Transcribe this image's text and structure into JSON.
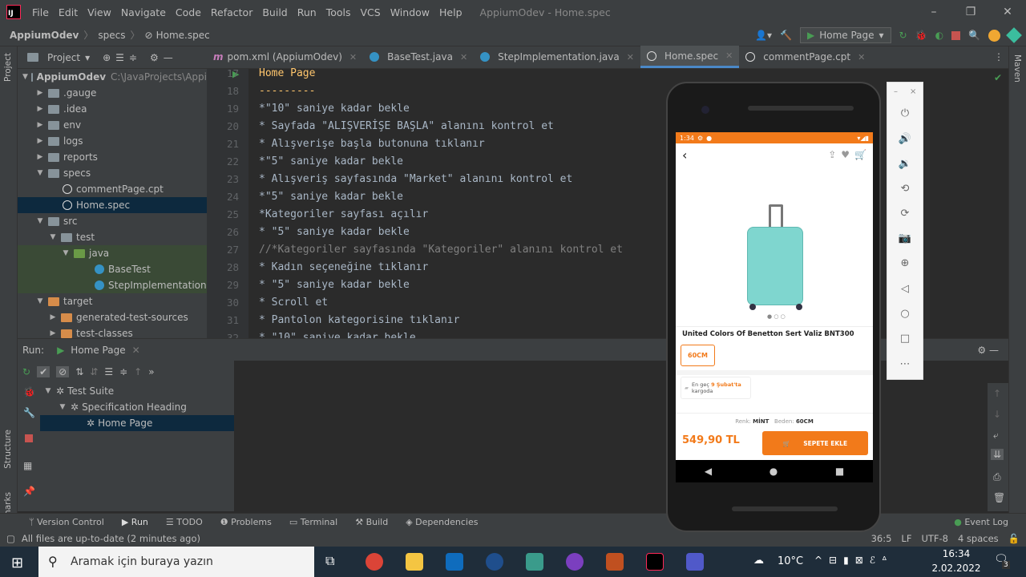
{
  "menu": {
    "items": [
      "File",
      "Edit",
      "View",
      "Navigate",
      "Code",
      "Refactor",
      "Build",
      "Run",
      "Tools",
      "VCS",
      "Window",
      "Help"
    ],
    "title": "AppiumOdev - Home.spec"
  },
  "nav": {
    "project": "AppiumOdev",
    "crumb1": "specs",
    "crumb2": "Home.spec",
    "run_config": "Home Page"
  },
  "project_panel": {
    "title": "Project",
    "root": "AppiumOdev",
    "root_path": "C:\\JavaProjects\\Appi",
    "items": [
      ".gauge",
      ".idea",
      "env",
      "logs",
      "reports",
      "specs",
      "commentPage.cpt",
      "Home.spec",
      "src",
      "test",
      "java",
      "BaseTest",
      "StepImplementation",
      "target",
      "generated-test-sources",
      "test-classes"
    ]
  },
  "tabs": [
    "pom.xml (AppiumOdev)",
    "BaseTest.java",
    "StepImplementation.java",
    "Home.spec",
    "commentPage.cpt"
  ],
  "editor": {
    "lines": [
      {
        "n": "17",
        "t": "Home Page"
      },
      {
        "n": "18",
        "t": "---------"
      },
      {
        "n": "19",
        "t": "*\"10\" saniye kadar bekle"
      },
      {
        "n": "20",
        "t": "* Sayfada \"ALIŞVERİŞE BAŞLA\" alanını kontrol et"
      },
      {
        "n": "21",
        "t": "* Alışverişe başla butonuna tıklanır"
      },
      {
        "n": "22",
        "t": "*\"5\" saniye kadar bekle"
      },
      {
        "n": "23",
        "t": "* Alışveriş sayfasında \"Market\" alanını kontrol et"
      },
      {
        "n": "24",
        "t": "*\"5\" saniye kadar bekle"
      },
      {
        "n": "25",
        "t": "*Kategoriler sayfası açılır"
      },
      {
        "n": "26",
        "t": "* \"5\" saniye kadar bekle"
      },
      {
        "n": "27",
        "t": "//*Kategoriler sayfasında \"Kategoriler\" alanını kontrol et"
      },
      {
        "n": "28",
        "t": "* Kadın seçeneğine tıklanır"
      },
      {
        "n": "29",
        "t": "* \"5\" saniye kadar bekle"
      },
      {
        "n": "30",
        "t": "* Scroll et"
      },
      {
        "n": "31",
        "t": "* Pantolon kategorisine tıklanır"
      },
      {
        "n": "32",
        "t": "* \"10\" saniye kadar bekle"
      }
    ]
  },
  "run": {
    "label": "Run:",
    "tab": "Home Page",
    "tree": [
      "Test Suite",
      "Specification Heading",
      "Home Page"
    ]
  },
  "bottom_tools": [
    "Version Control",
    "Run",
    "TODO",
    "Problems",
    "Terminal",
    "Build",
    "Dependencies"
  ],
  "event_log": "Event Log",
  "status": {
    "message": "All files are up-to-date (2 minutes ago)",
    "position": "36:5",
    "line_sep": "LF",
    "encoding": "UTF-8",
    "indent": "4 spaces"
  },
  "phone": {
    "time": "1:34",
    "product_name": "United Colors Of Benetton Sert Valiz BNT300",
    "size_option": "60CM",
    "delivery_prefix": "En geç",
    "delivery_date": "9 Şubat'ta",
    "delivery_suffix": "kargoda",
    "color_label": "Renk:",
    "color_value": "MİNT",
    "size_label": "Beden:",
    "size_value": "60CM",
    "price": "549,90 TL",
    "cart_button": "SEPETE EKLE"
  },
  "taskbar": {
    "search_placeholder": "Aramak için buraya yazın",
    "weather": "10°C",
    "time": "16:34",
    "date": "2.02.2022",
    "notif_count": "3"
  }
}
